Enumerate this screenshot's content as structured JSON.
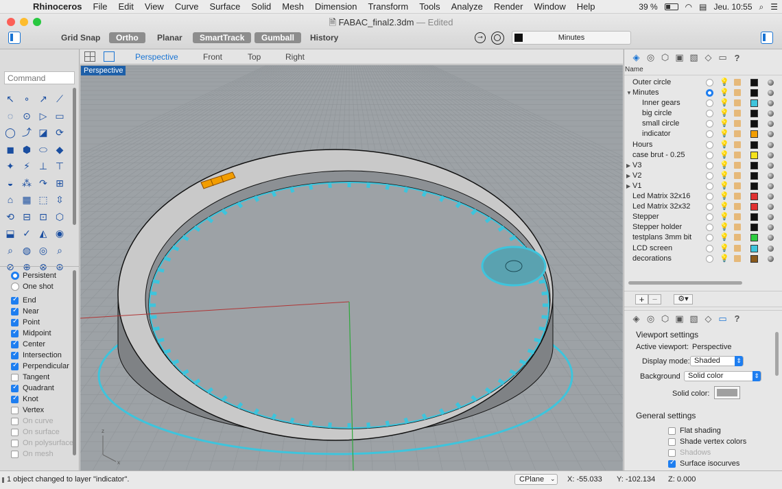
{
  "menubar": {
    "app": "Rhinoceros",
    "items": [
      "File",
      "Edit",
      "View",
      "Curve",
      "Surface",
      "Solid",
      "Mesh",
      "Dimension",
      "Transform",
      "Tools",
      "Analyze",
      "Render",
      "Window",
      "Help"
    ],
    "battery": "39 %",
    "clock": "Jeu. 10:55"
  },
  "window": {
    "title": "FABAC_final2.3dm",
    "edited": "— Edited"
  },
  "toolbar": {
    "grid_snap": "Grid Snap",
    "ortho": "Ortho",
    "planar": "Planar",
    "smarttrack": "SmartTrack",
    "gumball": "Gumball",
    "history": "History",
    "units": "Minutes"
  },
  "command": {
    "placeholder": "Command"
  },
  "viewport_tabs": [
    "Perspective",
    "Front",
    "Top",
    "Right"
  ],
  "viewport": {
    "label": "Perspective"
  },
  "osnap": {
    "modes": [
      {
        "label": "Persistent",
        "type": "radio",
        "on": true
      },
      {
        "label": "One shot",
        "type": "radio",
        "on": false
      }
    ],
    "items": [
      {
        "label": "End",
        "on": true
      },
      {
        "label": "Near",
        "on": true
      },
      {
        "label": "Point",
        "on": true
      },
      {
        "label": "Midpoint",
        "on": true
      },
      {
        "label": "Center",
        "on": true
      },
      {
        "label": "Intersection",
        "on": true
      },
      {
        "label": "Perpendicular",
        "on": true
      },
      {
        "label": "Tangent",
        "on": false
      },
      {
        "label": "Quadrant",
        "on": true
      },
      {
        "label": "Knot",
        "on": true
      },
      {
        "label": "Vertex",
        "on": false
      },
      {
        "label": "On curve",
        "on": false,
        "dim": true
      },
      {
        "label": "On surface",
        "on": false,
        "dim": true
      },
      {
        "label": "On polysurface",
        "on": false,
        "dim": true
      },
      {
        "label": "On mesh",
        "on": false,
        "dim": true
      }
    ]
  },
  "layers": {
    "header": "Name",
    "rows": [
      {
        "name": "Outer circle",
        "level": 0,
        "color": "#111111",
        "bulb": false,
        "current": false
      },
      {
        "name": "Minutes",
        "level": 0,
        "expanded": true,
        "color": "#111111",
        "bulb": true,
        "current": true
      },
      {
        "name": "Inner gears",
        "level": 1,
        "color": "#3ec4dc",
        "bulb": true,
        "current": false
      },
      {
        "name": "big circle",
        "level": 1,
        "color": "#111111",
        "bulb": true,
        "current": false
      },
      {
        "name": "small circle",
        "level": 1,
        "color": "#111111",
        "bulb": true,
        "current": false
      },
      {
        "name": "indicator",
        "level": 1,
        "color": "#f29d00",
        "bulb": true,
        "current": false
      },
      {
        "name": "Hours",
        "level": 0,
        "color": "#111111",
        "bulb": false,
        "current": false
      },
      {
        "name": "case brut - 0.25",
        "level": 0,
        "color": "#f4e21c",
        "bulb": false,
        "current": false
      },
      {
        "name": "V3",
        "level": 0,
        "collapsed": true,
        "color": "#111111",
        "bulb": false,
        "current": false
      },
      {
        "name": "V2",
        "level": 0,
        "collapsed": true,
        "color": "#111111",
        "bulb": false,
        "current": false
      },
      {
        "name": "V1",
        "level": 0,
        "collapsed": true,
        "color": "#111111",
        "bulb": false,
        "current": false
      },
      {
        "name": "Led Matrix 32x16",
        "level": 0,
        "color": "#e03030",
        "bulb": false,
        "current": false
      },
      {
        "name": "Led Matrix 32x32",
        "level": 0,
        "color": "#e03030",
        "bulb": false,
        "current": false
      },
      {
        "name": "Stepper",
        "level": 0,
        "color": "#111111",
        "bulb": false,
        "current": false
      },
      {
        "name": "Stepper holder",
        "level": 0,
        "color": "#111111",
        "bulb": false,
        "current": false
      },
      {
        "name": "testplans 3mm bit",
        "level": 0,
        "color": "#2ecc40",
        "bulb": false,
        "current": false
      },
      {
        "name": "LCD screen",
        "level": 0,
        "color": "#3ec4dc",
        "bulb": false,
        "current": false
      },
      {
        "name": "decorations",
        "level": 0,
        "color": "#8a5a1c",
        "bulb": false,
        "current": false
      }
    ]
  },
  "viewport_settings": {
    "heading": "Viewport settings",
    "active_label": "Active viewport:",
    "active_value": "Perspective",
    "display_label": "Display mode:",
    "display_value": "Shaded",
    "bg_label": "Background",
    "bg_value": "Solid color",
    "solid_label": "Solid color:",
    "general_heading": "General settings",
    "options": [
      {
        "label": "Flat shading",
        "on": false,
        "dim": false
      },
      {
        "label": "Shade vertex colors",
        "on": false,
        "dim": false
      },
      {
        "label": "Shadows",
        "on": false,
        "dim": true
      },
      {
        "label": "Surface isocurves",
        "on": true,
        "dim": false
      }
    ]
  },
  "status": {
    "message": "1 object changed to layer \"indicator\".",
    "cplane": "CPlane",
    "x": "X: -55.033",
    "y": "Y: -102.134",
    "z": "Z: 0.000"
  },
  "colors": {
    "accent": "#1e7ef0",
    "gear": "#3ec4dc",
    "indicator": "#f29d00"
  },
  "icons": {
    "menubar": [
      "apple-icon",
      "wifi-icon",
      "battery-icon",
      "search-icon",
      "menu-list-icon"
    ],
    "toolbar": [
      "record-icon",
      "target-icon"
    ]
  }
}
